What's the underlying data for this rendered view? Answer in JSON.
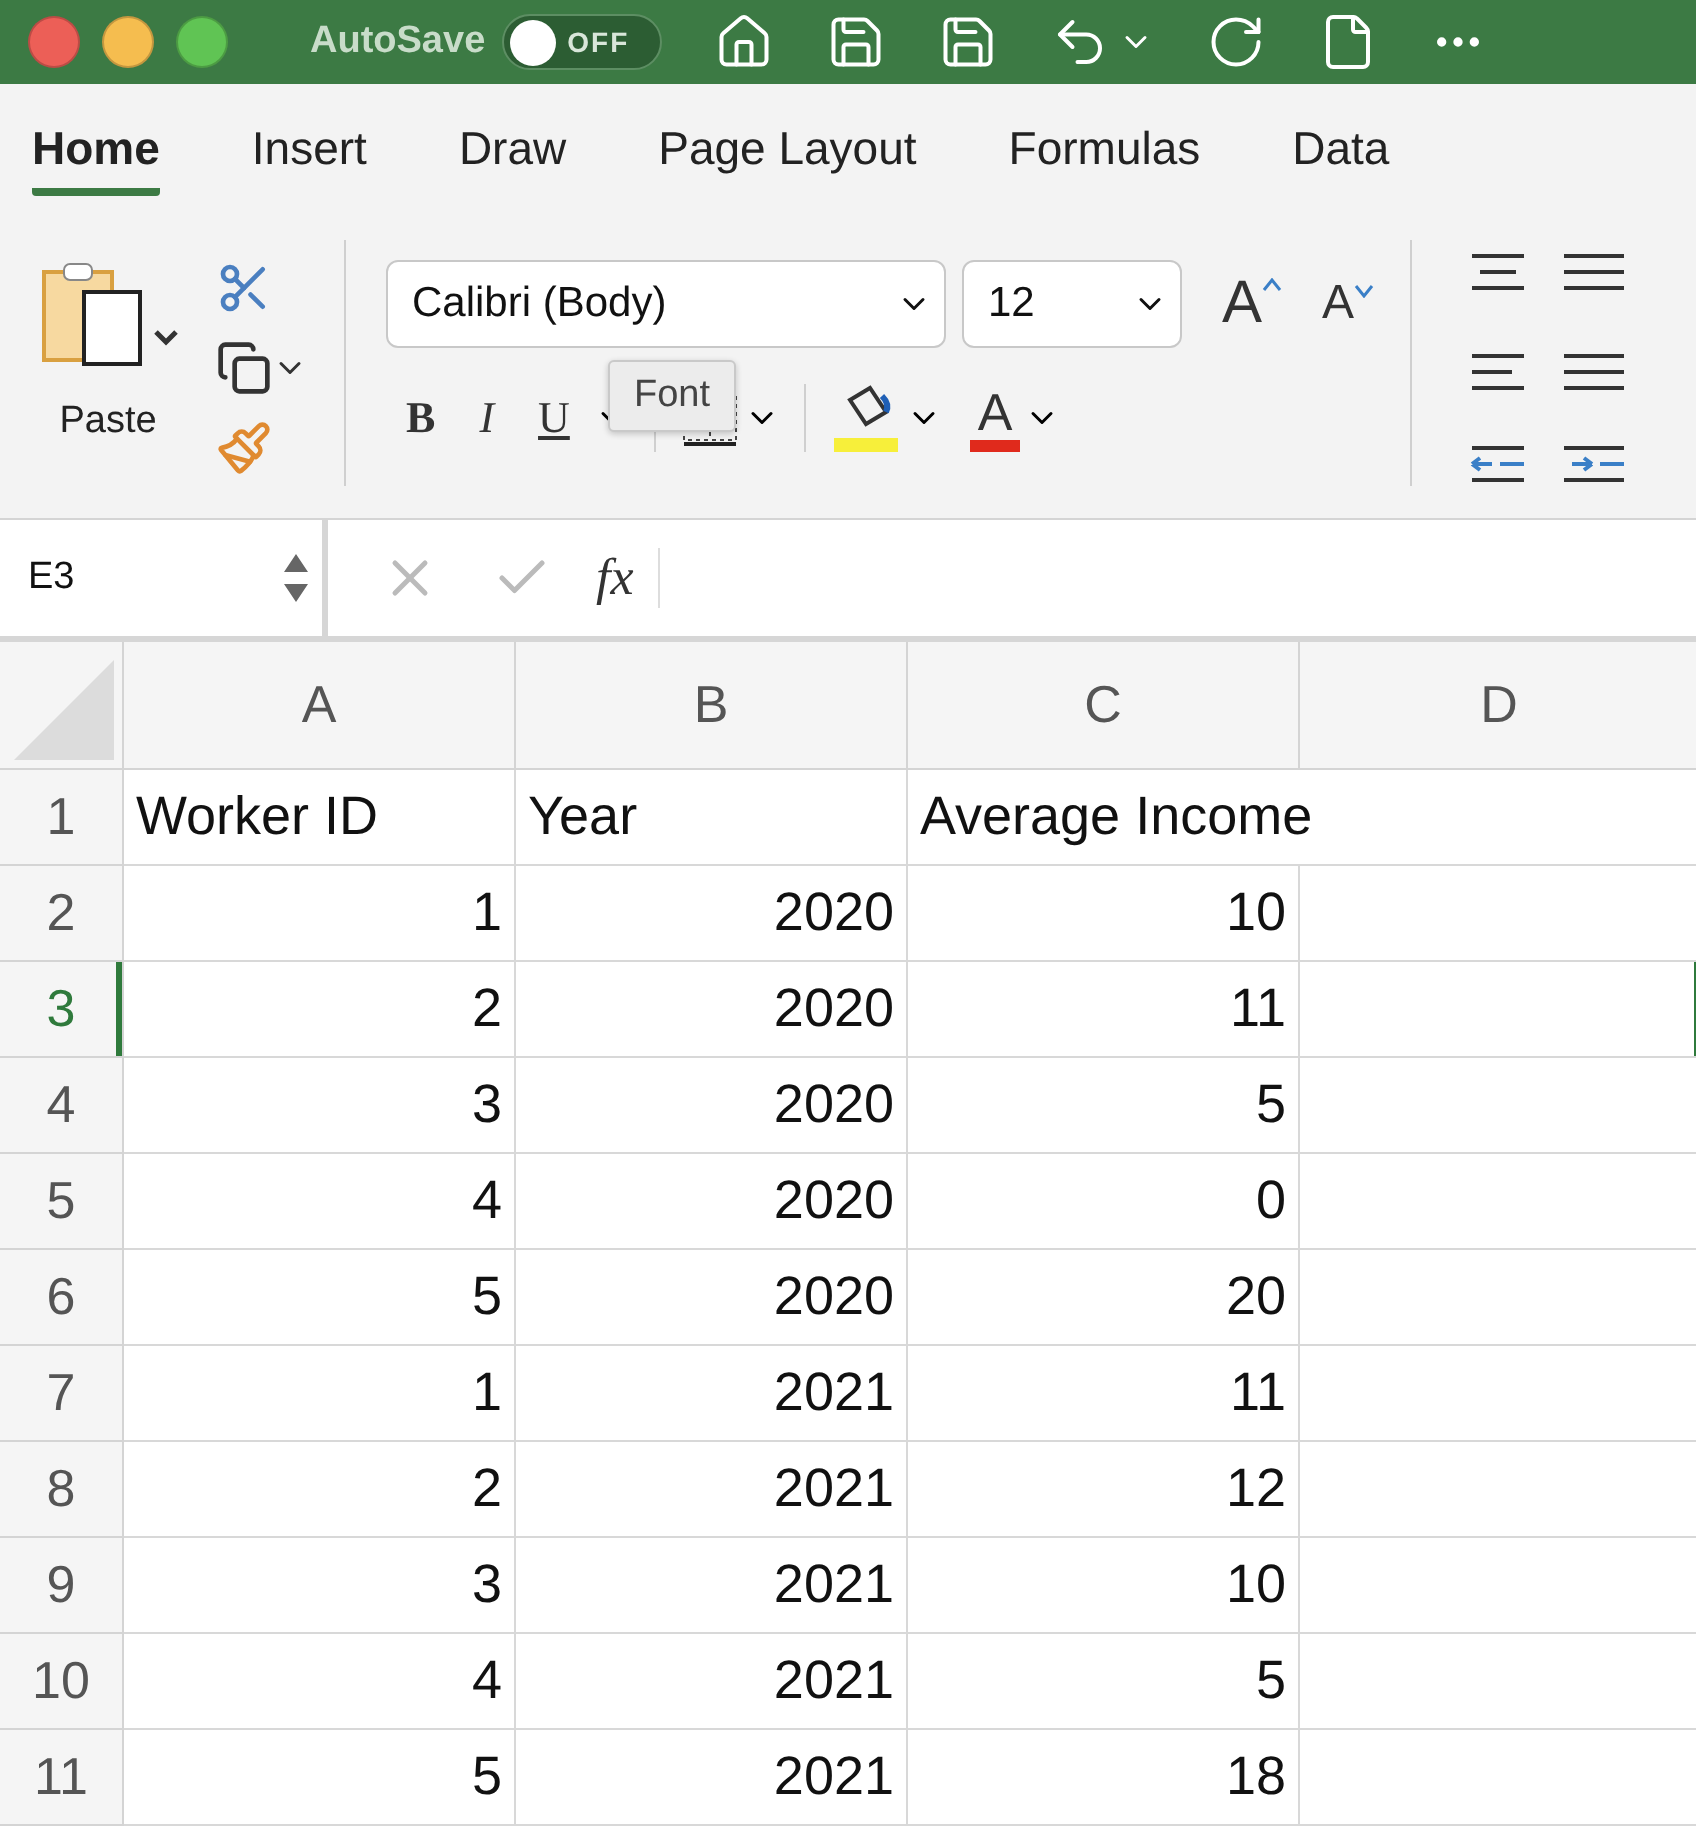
{
  "window": {
    "autosave_label": "AutoSave",
    "autosave_state": "OFF",
    "autosave_on": false
  },
  "tabs": [
    {
      "label": "Home",
      "selected": true
    },
    {
      "label": "Insert",
      "selected": false
    },
    {
      "label": "Draw",
      "selected": false
    },
    {
      "label": "Page Layout",
      "selected": false
    },
    {
      "label": "Formulas",
      "selected": false
    },
    {
      "label": "Data",
      "selected": false
    }
  ],
  "ribbon": {
    "paste_label": "Paste",
    "font_name": "Calibri (Body)",
    "font_size": "12",
    "grow_font": "A",
    "shrink_font": "A",
    "bold": "B",
    "italic": "I",
    "underline": "U",
    "font_color": "A",
    "tooltip": "Font"
  },
  "formula_bar": {
    "name_box": "E3",
    "fx": "fx"
  },
  "columns": [
    "A",
    "B",
    "C",
    "D"
  ],
  "rows": [
    {
      "number": "1",
      "selected": false,
      "kind": "header",
      "cells": [
        "Worker ID",
        "Year",
        "Average Income"
      ]
    },
    {
      "number": "2",
      "selected": false,
      "kind": "data",
      "cells": [
        "1",
        "2020",
        "10"
      ]
    },
    {
      "number": "3",
      "selected": true,
      "kind": "data",
      "cells": [
        "2",
        "2020",
        "11"
      ]
    },
    {
      "number": "4",
      "selected": false,
      "kind": "data",
      "cells": [
        "3",
        "2020",
        "5"
      ]
    },
    {
      "number": "5",
      "selected": false,
      "kind": "data",
      "cells": [
        "4",
        "2020",
        "0"
      ]
    },
    {
      "number": "6",
      "selected": false,
      "kind": "data",
      "cells": [
        "5",
        "2020",
        "20"
      ]
    },
    {
      "number": "7",
      "selected": false,
      "kind": "data",
      "cells": [
        "1",
        "2021",
        "11"
      ]
    },
    {
      "number": "8",
      "selected": false,
      "kind": "data",
      "cells": [
        "2",
        "2021",
        "12"
      ]
    },
    {
      "number": "9",
      "selected": false,
      "kind": "data",
      "cells": [
        "3",
        "2021",
        "10"
      ]
    },
    {
      "number": "10",
      "selected": false,
      "kind": "data",
      "cells": [
        "4",
        "2021",
        "5"
      ]
    },
    {
      "number": "11",
      "selected": false,
      "kind": "data",
      "cells": [
        "5",
        "2021",
        "18"
      ]
    }
  ]
}
